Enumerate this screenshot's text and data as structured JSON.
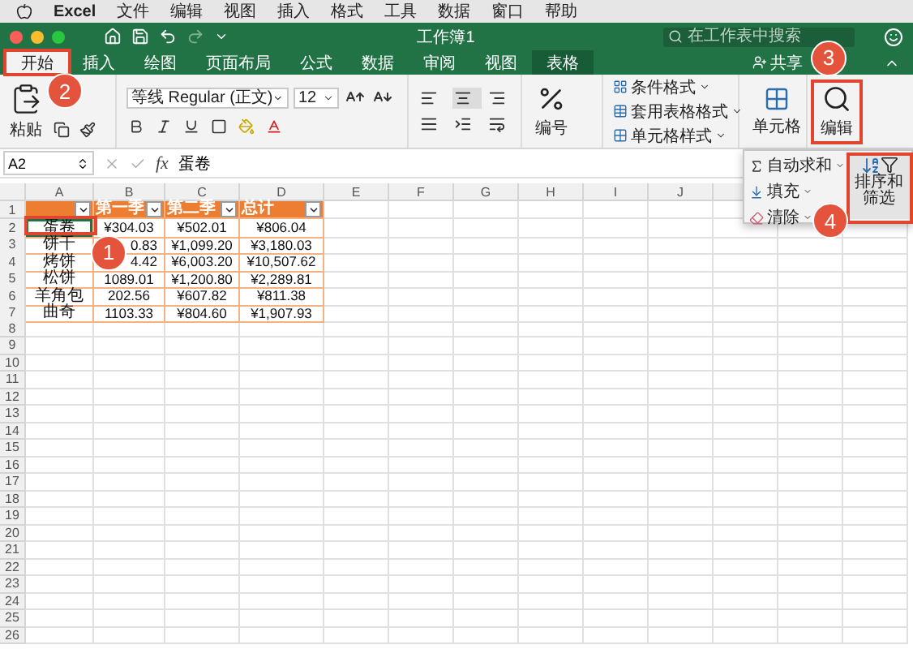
{
  "menu_bar": {
    "app": "Excel",
    "items": [
      "文件",
      "编辑",
      "视图",
      "插入",
      "格式",
      "工具",
      "数据",
      "窗口",
      "帮助"
    ]
  },
  "window": {
    "title": "工作簿1",
    "search": {
      "placeholder": "在工作表中搜索"
    },
    "redo": {
      "disabled": true
    }
  },
  "ribbon_tabs": [
    {
      "label": "开始",
      "selected": true,
      "kind": "standard",
      "callout": "2"
    },
    {
      "label": "插入",
      "selected": false,
      "kind": "standard"
    },
    {
      "label": "绘图",
      "selected": false,
      "kind": "standard"
    },
    {
      "label": "页面布局",
      "selected": false,
      "kind": "standard"
    },
    {
      "label": "公式",
      "selected": false,
      "kind": "standard"
    },
    {
      "label": "数据",
      "selected": false,
      "kind": "standard"
    },
    {
      "label": "审阅",
      "selected": false,
      "kind": "standard"
    },
    {
      "label": "视图",
      "selected": false,
      "kind": "standard"
    },
    {
      "label": "表格",
      "selected": false,
      "kind": "contextual"
    }
  ],
  "share": {
    "label": "共享"
  },
  "ribbon": {
    "paste": {
      "label": "粘贴"
    },
    "font": {
      "name": "等线 Regular (正文)",
      "size": "12"
    },
    "number": {
      "label": "编号"
    },
    "styles": [
      "条件格式",
      "套用表格格式",
      "单元格样式"
    ],
    "cells": {
      "label": "单元格"
    },
    "editing": {
      "label": "编辑",
      "callout": "3"
    }
  },
  "formula_bar": {
    "name_box": "A2",
    "fx": "fx",
    "value": "蛋卷"
  },
  "editing_menu": {
    "items": [
      {
        "label": "自动求和",
        "kind": "sum"
      },
      {
        "label": "填充",
        "kind": "fill"
      },
      {
        "label": "清除",
        "kind": "clear"
      }
    ],
    "sort_filter": {
      "label": "排序和筛选",
      "callout": "4"
    }
  },
  "sheet": {
    "columns": [
      "A",
      "B",
      "C",
      "D",
      "E",
      "F",
      "G",
      "H",
      "I",
      "J"
    ],
    "rows": [
      {
        "number": "1",
        "cells": [
          {
            "kind": "header",
            "filter": true,
            "selected": false
          },
          {
            "kind": "header",
            "text": "第一季",
            "filter": true,
            "selected": false
          },
          {
            "kind": "header",
            "text": "第二季",
            "filter": true,
            "selected": false
          },
          {
            "kind": "header",
            "text": "总计",
            "filter": true,
            "selected": false
          }
        ]
      },
      {
        "number": "2",
        "cells": [
          {
            "kind": "label",
            "text": "蛋卷",
            "selected": true,
            "callout": "1"
          },
          {
            "kind": "value",
            "text": "¥304.03",
            "selected": false
          },
          {
            "kind": "value",
            "text": "¥502.01",
            "selected": false
          },
          {
            "kind": "value",
            "text": "¥806.04",
            "selected": false
          }
        ]
      },
      {
        "number": "3",
        "cells": [
          {
            "kind": "label",
            "text": "饼干",
            "selected": false
          },
          {
            "kind": "clipped",
            "text": "0.83",
            "selected": false
          },
          {
            "kind": "value",
            "text": "¥1,099.20",
            "selected": false
          },
          {
            "kind": "value",
            "text": "¥3,180.03",
            "selected": false
          }
        ]
      },
      {
        "number": "4",
        "cells": [
          {
            "kind": "label",
            "text": "烤饼",
            "selected": false
          },
          {
            "kind": "clipped",
            "text": "4.42",
            "selected": false
          },
          {
            "kind": "value",
            "text": "¥6,003.20",
            "selected": false
          },
          {
            "kind": "value",
            "text": "¥10,507.62",
            "selected": false
          }
        ]
      },
      {
        "number": "5",
        "cells": [
          {
            "kind": "label",
            "text": "松饼",
            "selected": false
          },
          {
            "kind": "value",
            "text": "1089.01",
            "selected": false
          },
          {
            "kind": "value",
            "text": "¥1,200.80",
            "selected": false
          },
          {
            "kind": "value",
            "text": "¥2,289.81",
            "selected": false
          }
        ]
      },
      {
        "number": "6",
        "cells": [
          {
            "kind": "label",
            "text": "羊角包",
            "selected": false
          },
          {
            "kind": "value",
            "text": "202.56",
            "selected": false
          },
          {
            "kind": "value",
            "text": "¥607.82",
            "selected": false
          },
          {
            "kind": "value",
            "text": "¥811.38",
            "selected": false
          }
        ]
      },
      {
        "number": "7",
        "cells": [
          {
            "kind": "label",
            "text": "曲奇",
            "selected": false
          },
          {
            "kind": "value",
            "text": "1103.33",
            "selected": false
          },
          {
            "kind": "value",
            "text": "¥804.60",
            "selected": false
          },
          {
            "kind": "value",
            "text": "¥1,907.93",
            "selected": false
          }
        ]
      },
      {
        "number": "8"
      },
      {
        "number": "9"
      },
      {
        "number": "10"
      },
      {
        "number": "11"
      },
      {
        "number": "12"
      },
      {
        "number": "13"
      },
      {
        "number": "14"
      },
      {
        "number": "15"
      },
      {
        "number": "16"
      },
      {
        "number": "17"
      },
      {
        "number": "18"
      },
      {
        "number": "19"
      },
      {
        "number": "20"
      },
      {
        "number": "21"
      },
      {
        "number": "22"
      },
      {
        "number": "23"
      },
      {
        "number": "24"
      },
      {
        "number": "25"
      },
      {
        "number": "26"
      }
    ]
  }
}
